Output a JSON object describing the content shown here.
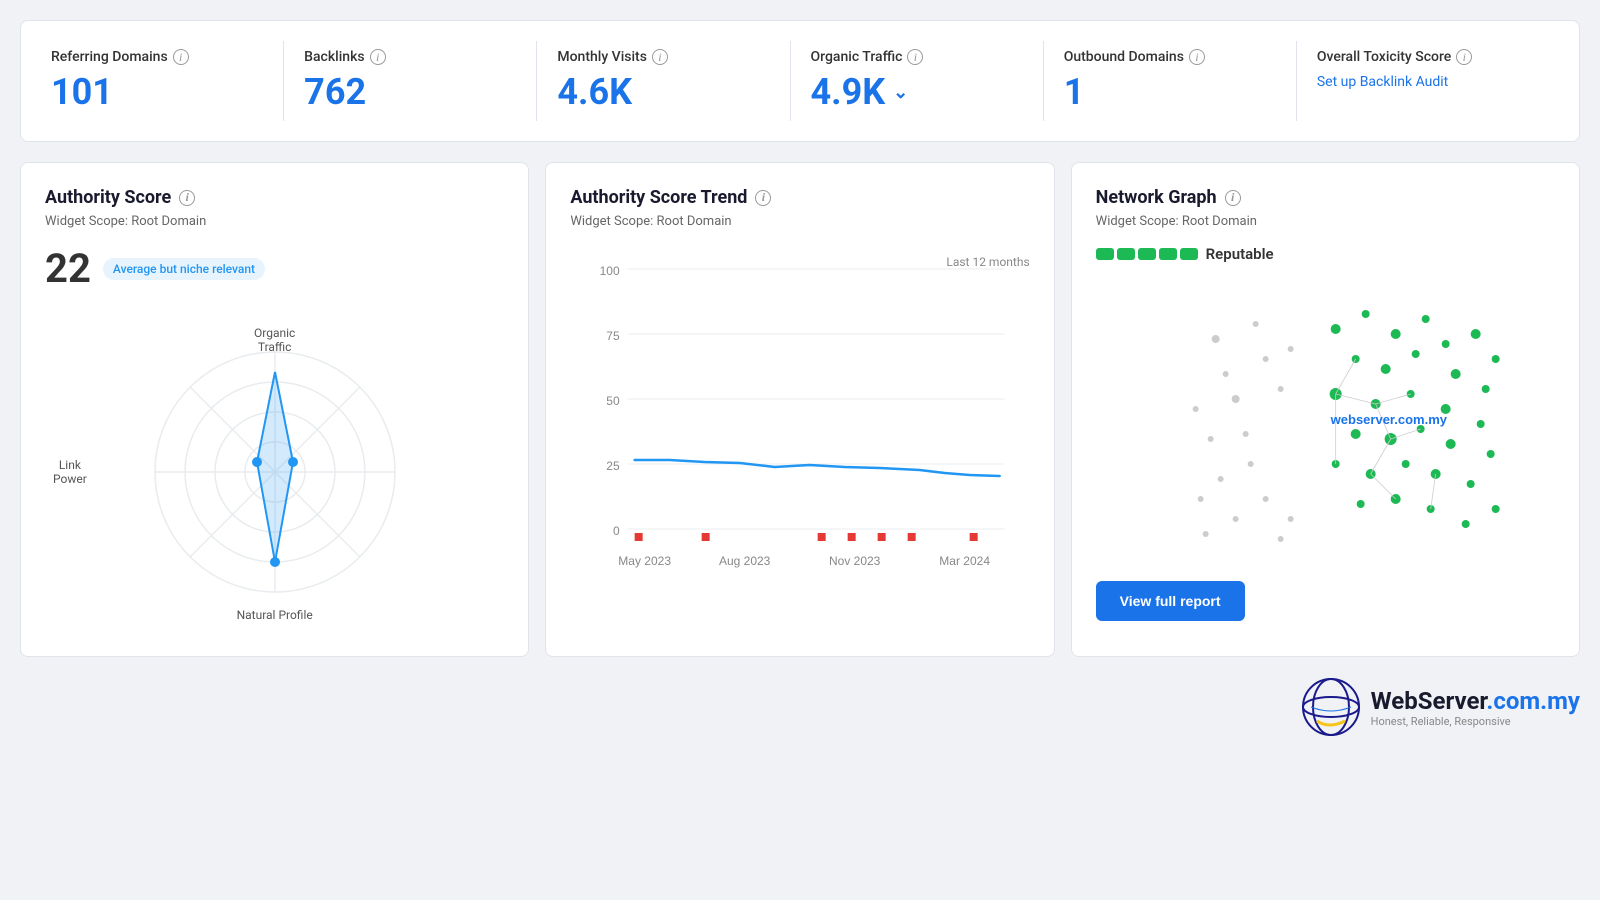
{
  "header": {
    "stats": [
      {
        "id": "referring-domains",
        "label": "Referring Domains",
        "value": "101",
        "type": "number"
      },
      {
        "id": "backlinks",
        "label": "Backlinks",
        "value": "762",
        "type": "number"
      },
      {
        "id": "monthly-visits",
        "label": "Monthly Visits",
        "value": "4.6K",
        "type": "number"
      },
      {
        "id": "organic-traffic",
        "label": "Organic Traffic",
        "value": "4.9K",
        "type": "number-chevron"
      },
      {
        "id": "outbound-domains",
        "label": "Outbound Domains",
        "value": "1",
        "type": "number"
      },
      {
        "id": "toxicity-score",
        "label": "Overall Toxicity Score",
        "value": "",
        "type": "link",
        "link_text": "Set up Backlink Audit"
      }
    ]
  },
  "authority_score": {
    "title": "Authority Score",
    "scope": "Widget Scope: Root Domain",
    "score": "22",
    "badge": "Average but niche relevant",
    "labels": {
      "link_power": "Link\nPower",
      "organic_traffic": "Organic\nTraffic",
      "natural_profile": "Natural Profile"
    }
  },
  "authority_trend": {
    "title": "Authority Score Trend",
    "scope": "Widget Scope: Root Domain",
    "period": "Last 12 months",
    "y_labels": [
      "100",
      "75",
      "50",
      "25",
      "0"
    ],
    "x_labels": [
      "May 2023",
      "Aug 2023",
      "Nov 2023",
      "Mar 2024"
    ]
  },
  "network_graph": {
    "title": "Network Graph",
    "scope": "Widget Scope: Root Domain",
    "reputation": "Reputable",
    "domain": "webserver.com.my",
    "button_label": "View full report"
  },
  "footer": {
    "logo_text_before": "WebServer",
    "logo_text_after": ".com.my",
    "tagline": "Honest, Reliable, Responsive"
  }
}
